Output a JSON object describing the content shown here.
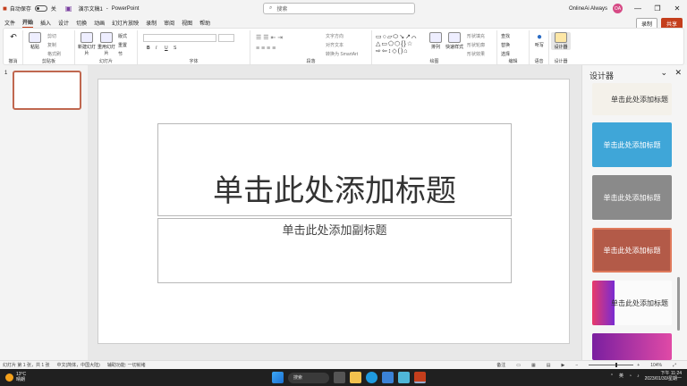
{
  "titlebar": {
    "autosave_label": "自动保存",
    "autosave_state": "关",
    "doc_name": "演示文稿1",
    "separator": "-",
    "app_name": "PowerPoint",
    "search_placeholder": "搜索",
    "user_name": "OnlineAi Always",
    "avatar_initials": "OA"
  },
  "tabs": [
    "文件",
    "开始",
    "插入",
    "设计",
    "切换",
    "动画",
    "幻灯片放映",
    "录制",
    "审阅",
    "视图",
    "帮助"
  ],
  "active_tab": "开始",
  "tab_actions": {
    "record": "录制",
    "share": "共享"
  },
  "ribbon": {
    "undo_label": "撤消",
    "clipboard": {
      "paste": "粘贴",
      "cut": "剪切",
      "copy": "复制",
      "format_painter": "格式刷",
      "label": "剪贴板"
    },
    "slides": {
      "new_slide": "新建幻灯片",
      "reuse": "重用幻灯片",
      "layout": "版式",
      "reset": "重置",
      "section": "节",
      "label": "幻灯片"
    },
    "font": {
      "label": "字体",
      "bold": "B",
      "italic": "I",
      "underline": "U",
      "strike": "S"
    },
    "paragraph": {
      "label": "段落",
      "text_direction": "文字方向",
      "align_text": "对齐文本",
      "smartart": "转换为 SmartArt"
    },
    "drawing": {
      "label": "绘图",
      "arrange": "排列",
      "quick_styles": "快速样式",
      "fill": "形状填充",
      "outline": "形状轮廓",
      "effects": "形状效果"
    },
    "editing": {
      "label": "编辑",
      "find": "查找",
      "replace": "替换",
      "select": "选择"
    },
    "voice": {
      "label": "语音",
      "dictate": "听写"
    },
    "designer": {
      "label": "设计器",
      "button": "设计器"
    }
  },
  "slides_pane": {
    "slide_number": "1"
  },
  "slide": {
    "title_placeholder": "单击此处添加标题",
    "subtitle_placeholder": "单击此处添加副标题"
  },
  "design_pane": {
    "title": "设计器",
    "cards": [
      {
        "text": "单击此处添加标题",
        "bg": "#f4f1ea",
        "fg": "#333"
      },
      {
        "text": "单击此处添加标题",
        "bg": "#3fa6d8",
        "fg": "#ffffff"
      },
      {
        "text": "单击此处添加标题",
        "bg": "#8a8a8a",
        "fg": "#ffffff"
      },
      {
        "text": "单击此处添加标题",
        "bg": "#b35a48",
        "fg": "#ffffff"
      },
      {
        "text": "单击此处添加标题",
        "bg": "#fbfbfb",
        "fg": "#333"
      },
      {
        "text": "",
        "bg": "#c13cc4",
        "fg": "#ffffff"
      }
    ]
  },
  "statusbar": {
    "slide_info": "幻灯片 第 1 张，共 1 张",
    "language": "中文(简体，中国大陆)",
    "accessibility": "辅助功能: 一切就绪",
    "notes": "备注",
    "zoom": "104%"
  },
  "taskbar": {
    "temperature": "13°C",
    "weather": "晴朗",
    "search": "搜索",
    "ime": "英",
    "time": "下午 11:24",
    "date": "2023/01/30/星期一"
  },
  "colors": {
    "accent": "#c43e1c",
    "selected_border": "#c0674f"
  }
}
